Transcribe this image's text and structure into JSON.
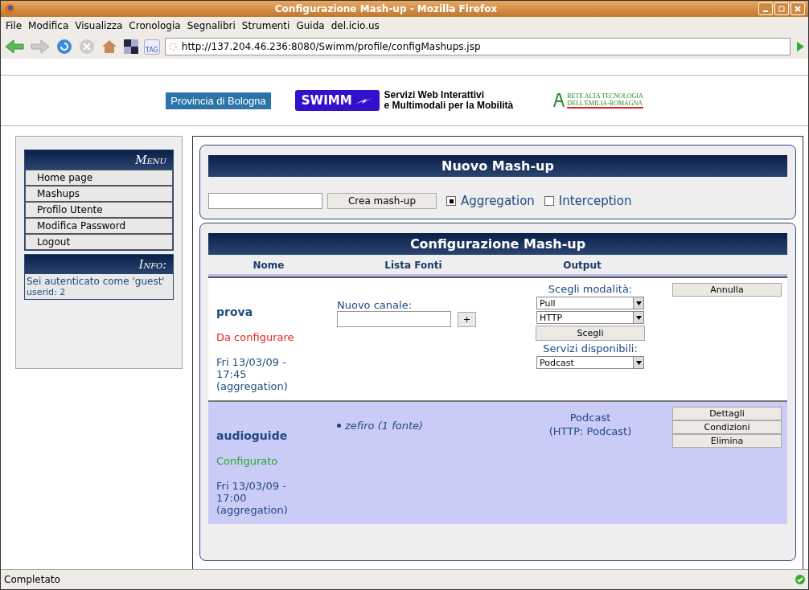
{
  "window": {
    "title": "Configurazione Mash-up - Mozilla Firefox"
  },
  "menubar": [
    "File",
    "Modifica",
    "Visualizza",
    "Cronologia",
    "Segnalibri",
    "Strumenti",
    "Guida",
    "del.icio.us"
  ],
  "toolbar": {
    "tag_label": "TAG",
    "url": "http://137.204.46.236:8080/Swimm/profile/configMashups.jsp"
  },
  "header": {
    "province": "Provincia di Bologna",
    "swimm": "SWIMM",
    "tagline": [
      "Servizi Web Interattivi",
      "e Multimodali per la Mobilità"
    ],
    "network": [
      "RETE ALTA TECNOLOGIA",
      "DELL'EMILIA-ROMAGNA"
    ]
  },
  "sidebar": {
    "menu_title": "Menu",
    "items": [
      "Home page",
      "Mashups",
      "Profilo Utente",
      "Modifica Password",
      "Logout"
    ],
    "info_title": "Info:",
    "info_text": "Sei autenticato come 'guest'",
    "userid": "userid: 2"
  },
  "new_mashup": {
    "title": "Nuovo Mash-up",
    "button": "Crea mash-up",
    "radios": [
      {
        "label": "Aggregation",
        "selected": true
      },
      {
        "label": "Interception",
        "selected": false
      }
    ]
  },
  "config": {
    "title": "Configurazione Mash-up",
    "columns": [
      "Nome",
      "Lista Fonti",
      "Output"
    ],
    "rows": [
      {
        "kind": "pending",
        "name": "prova",
        "status": "Da configurare",
        "color": "#ee2222",
        "date": [
          "Fri 13/03/09 -",
          "17:45",
          "(aggregation)"
        ],
        "channel_label": "Nuovo canale:",
        "add_button": "+",
        "mode_label": "Scegli modalità:",
        "selects": [
          "Pull",
          "HTTP"
        ],
        "choose_button": "Scegli",
        "services_label": "Servizi disponibili:",
        "service": "Podcast",
        "actions": [
          "Annulla"
        ]
      },
      {
        "kind": "configured",
        "name": "audioguide",
        "status": "Configurato",
        "color": "#22aa22",
        "date": [
          "Fri 13/03/09 -",
          "17:00",
          "(aggregation)"
        ],
        "sources": [
          "zefiro (1 fonte)"
        ],
        "output": [
          "Podcast",
          "(HTTP: Podcast)"
        ],
        "actions": [
          "Dettagli",
          "Condizioni",
          "Elimina"
        ]
      }
    ]
  },
  "status_bar": {
    "text": "Completato"
  }
}
